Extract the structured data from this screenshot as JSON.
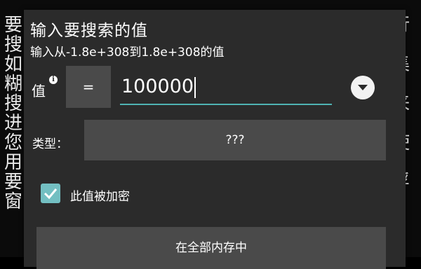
{
  "background": {
    "left_column": [
      "要",
      "搜",
      "如",
      "糊",
      "搜",
      "进",
      "您",
      "用",
      "要",
      "窗"
    ],
    "right_column": [
      "行",
      "",
      "集",
      "",
      "来",
      "",
      "使",
      "",
      "浮"
    ]
  },
  "dialog": {
    "title": "输入要搜索的值",
    "subtitle": "输入从-1.8e+308到1.8e+308的值",
    "value_label": "值",
    "info_icon_glyph": "i",
    "operator": "=",
    "value": "100000",
    "type_label": "类型：",
    "type_value": "???",
    "encrypted_checkbox": {
      "label": "此值被加密",
      "checked": true
    },
    "search_button": "在全部内存中"
  },
  "colors": {
    "accent": "#4fb3b3",
    "checkbox": "#73bfc2",
    "dialog_bg": "#2b2b2b",
    "button_bg": "#4a4a4a"
  },
  "icons": {
    "info": "info-icon",
    "dropdown": "chevron-down-icon",
    "checkbox": "checkmark-icon"
  }
}
